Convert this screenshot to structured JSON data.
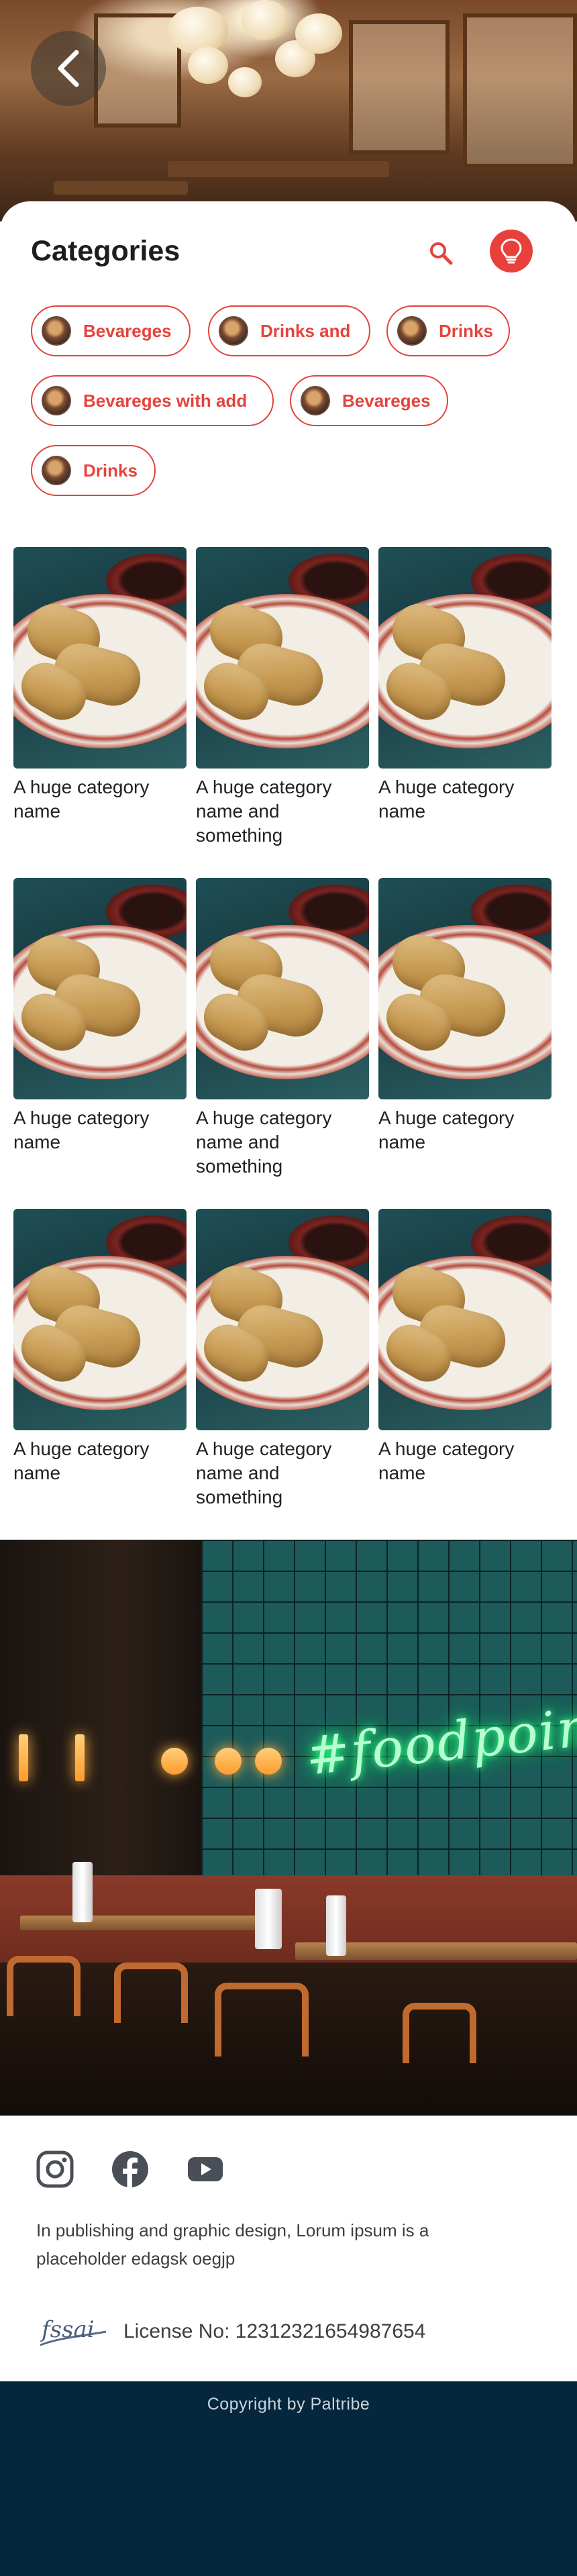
{
  "header": {
    "back_icon": "chevron-left-icon"
  },
  "categories": {
    "title": "Categories",
    "search_icon": "search-icon",
    "bulb_icon": "lightbulb-icon",
    "chips": [
      {
        "label": "Bevareges"
      },
      {
        "label": "Drinks and"
      },
      {
        "label": "Drinks"
      },
      {
        "label": "Bevareges with add"
      },
      {
        "label": "Bevareges"
      },
      {
        "label": "Drinks"
      }
    ]
  },
  "grid": {
    "items": [
      {
        "name": "A huge category name"
      },
      {
        "name": "A huge category name and something"
      },
      {
        "name": "A huge category name"
      },
      {
        "name": "A huge category name"
      },
      {
        "name": "A huge category name and something"
      },
      {
        "name": "A huge category name"
      },
      {
        "name": "A huge category name"
      },
      {
        "name": "A huge category name and something"
      },
      {
        "name": "A huge category name"
      }
    ]
  },
  "restaurant_banner": {
    "neon_text": "#foodpoint"
  },
  "footer": {
    "social": [
      "instagram-icon",
      "facebook-icon",
      "youtube-icon"
    ],
    "about": "In publishing and graphic design, Lorum ipsum is a placeholder edagsk oegjp",
    "fssai_logo_text": "fssai",
    "license": "License No: 12312321654987654",
    "copyright": "Copyright by Paltribe"
  },
  "colors": {
    "accent": "#e4433c",
    "footer_bar": "#05263d"
  }
}
